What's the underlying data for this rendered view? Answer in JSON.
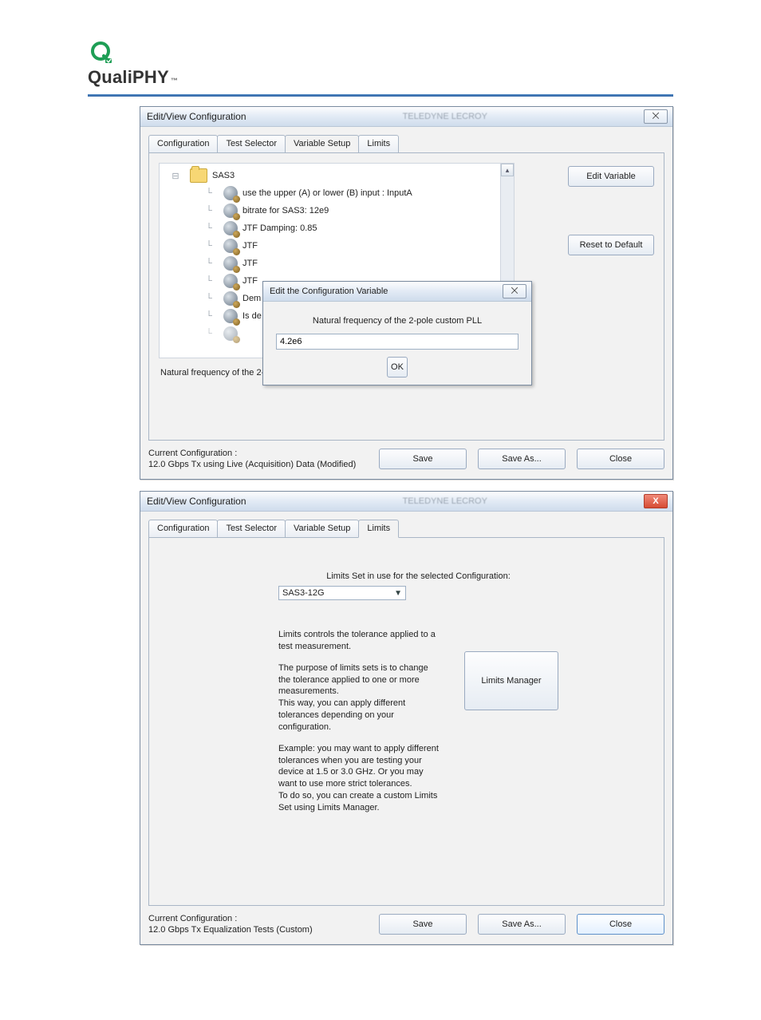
{
  "logo": {
    "name": "QualiPHY",
    "tm": "™"
  },
  "win1": {
    "title": "Edit/View Configuration",
    "closeGlyph": "⨉",
    "tabs": [
      "Configuration",
      "Test Selector",
      "Variable Setup",
      "Limits"
    ],
    "activeTab": "Variable Setup",
    "tree": {
      "root": "SAS3",
      "items": [
        "use the upper (A) or lower (B) input : InputA",
        "bitrate for SAS3: 12e9",
        "JTF Damping: 0.85",
        "JTF",
        "JTF",
        "JTF",
        "Dem",
        "Is de"
      ]
    },
    "sideButtons": {
      "edit": "Edit Variable",
      "reset": "Reset to Default"
    },
    "statusText": "Natural frequency of the 2-pole custom PLL",
    "footer": {
      "label": "Current Configuration :",
      "config": "12.0 Gbps Tx using Live (Acquisition) Data  (Modified)",
      "save": "Save",
      "saveAs": "Save As...",
      "close": "Close"
    },
    "modal": {
      "title": "Edit the Configuration Variable",
      "closeGlyph": "⨉",
      "desc": "Natural frequency of the 2-pole custom PLL",
      "value": "4.2e6",
      "ok": "OK"
    }
  },
  "win2": {
    "title": "Edit/View Configuration",
    "closeX": "X",
    "tabs": [
      "Configuration",
      "Test Selector",
      "Variable Setup",
      "Limits"
    ],
    "activeTab": "Limits",
    "limits": {
      "heading": "Limits Set in use for the selected Configuration:",
      "setName": "SAS3-12G",
      "p1": "Limits controls the tolerance applied to a test measurement.",
      "p2": "The purpose of limits sets is to change the tolerance applied to one or more measurements.\nThis way, you can apply different tolerances depending on your configuration.",
      "p3": "Example: you may want to apply different tolerances when you are testing your device at 1.5 or 3.0 GHz. Or you may want to use more strict tolerances.\nTo do so, you can create a custom Limits Set using Limits Manager.",
      "managerBtn": "Limits Manager"
    },
    "footer": {
      "label": "Current Configuration :",
      "config": "12.0 Gbps Tx Equalization Tests (Custom)",
      "save": "Save",
      "saveAs": "Save As...",
      "close": "Close"
    }
  }
}
